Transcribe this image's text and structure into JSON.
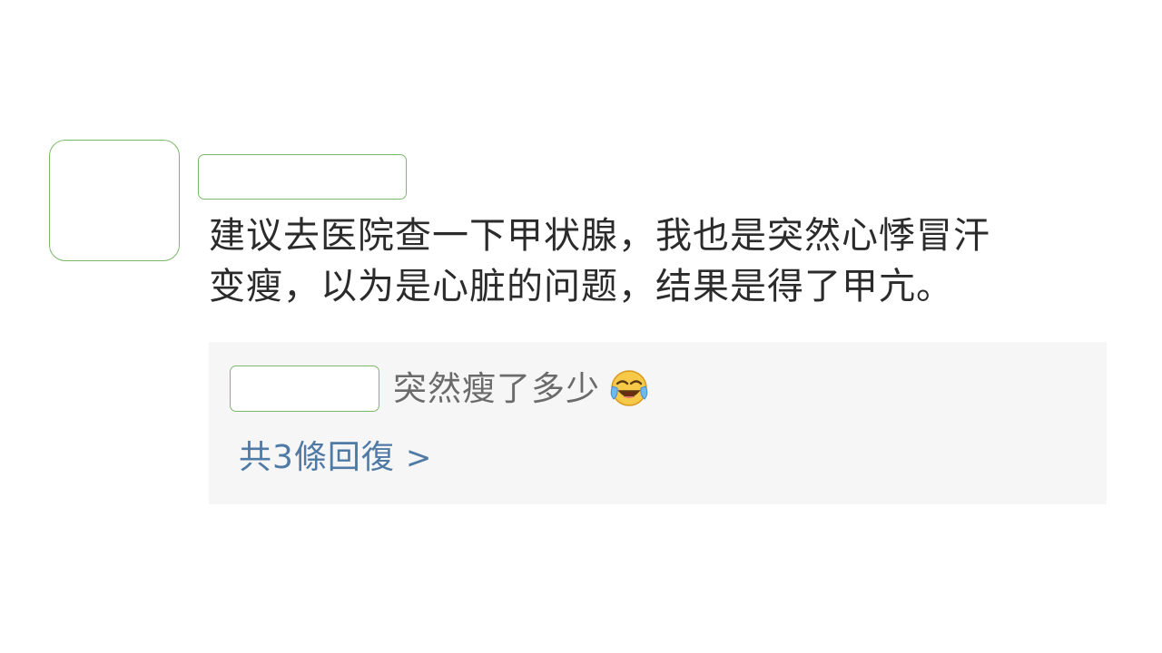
{
  "comment": {
    "text": "建议去医院查一下甲状腺，我也是突然心悸冒汗\n变瘦，以为是心脏的问题，结果是得了甲亢。"
  },
  "reply": {
    "text": "突然瘦了多少",
    "emoji": "laughing-crying-emoji"
  },
  "more_replies": {
    "label": "共3條回復",
    "chevron": ">"
  }
}
